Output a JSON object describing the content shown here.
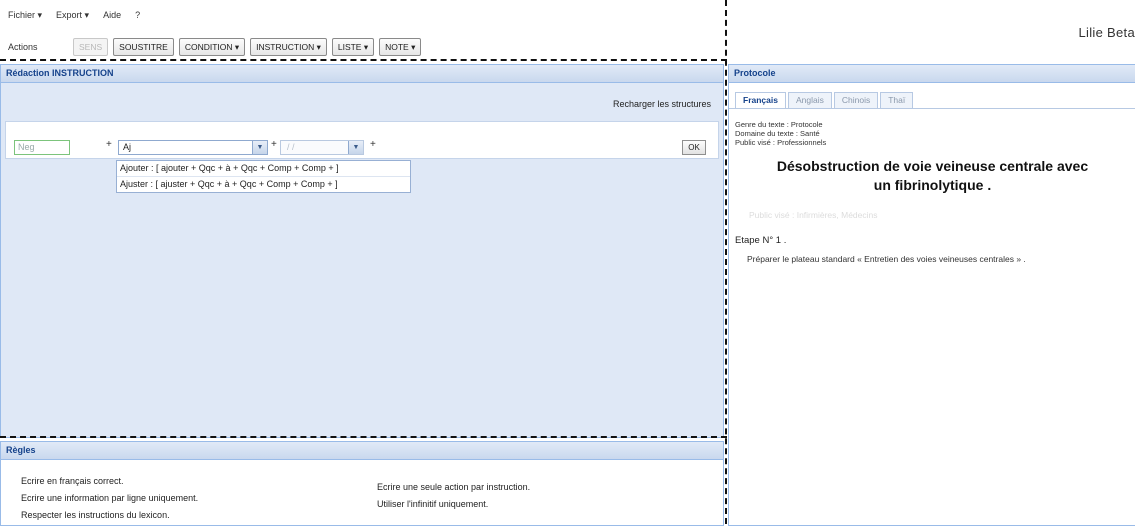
{
  "menu": {
    "items": [
      "Fichier ▾",
      "Export ▾",
      "Aide",
      "?"
    ]
  },
  "app_title": "Lilie Beta",
  "toolbar": {
    "actions_label": "Actions",
    "buttons": [
      "SENS",
      "SOUSTITRE",
      "CONDITION ▾",
      "INSTRUCTION ▾",
      "LISTE ▾",
      "NOTE ▾"
    ]
  },
  "left_panel": {
    "title": "Rédaction INSTRUCTION",
    "reload_label": "Recharger les structures",
    "neg_placeholder": "Neg",
    "plus_signs": [
      "+",
      "+",
      "+"
    ],
    "verb_value": "Aj",
    "second_value": "/ /",
    "ok_label": "OK",
    "suggestions": [
      "Ajouter : [ ajouter + Qqc + à + Qqc + Comp + Comp + ]",
      "Ajuster : [ ajuster + Qqc + à + Qqc + Comp + Comp + ]"
    ]
  },
  "rules_panel": {
    "title": "Règles",
    "col1": [
      "Ecrire en français correct.",
      "Ecrire une information par ligne uniquement.",
      "Respecter les instructions du lexicon."
    ],
    "col2": [
      "Ecrire une seule action par instruction.",
      "Utiliser l'infinitif uniquement."
    ]
  },
  "right_panel": {
    "title": "Protocole",
    "tabs": [
      "Français",
      "Anglais",
      "Chinois",
      "Thaï"
    ],
    "meta": [
      "Genre du texte : Protocole",
      "Domaine du texte : Santé",
      "Public visé : Professionnels"
    ],
    "doc_title_line1": "Désobstruction de voie veineuse centrale avec",
    "doc_title_line2": "un fibrinolytique .",
    "faded_text": "Public visé : Infirmières, Médecins",
    "step_label": "Etape N° 1 .",
    "step_text": "Préparer le plateau standard « Entretien des voies veineuses centrales » ."
  },
  "colors": {
    "panel_bg": "#dfe8f6",
    "panel_border": "#99bbe8",
    "header_text": "#15428b"
  }
}
